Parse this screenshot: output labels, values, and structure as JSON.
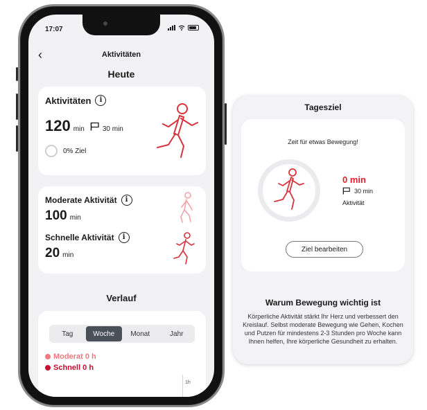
{
  "status_bar": {
    "time": "17:07"
  },
  "nav": {
    "back_glyph": "‹",
    "title": "Aktivitäten"
  },
  "today": {
    "heading": "Heute",
    "activities_card": {
      "label": "Aktivitäten",
      "value": "120",
      "unit": "min",
      "goal": "30 min",
      "goal_progress": "0% Ziel"
    },
    "split_card": {
      "moderate_label": "Moderate Aktivität",
      "moderate_value": "100",
      "moderate_unit": "min",
      "fast_label": "Schnelle Aktivität",
      "fast_value": "20",
      "fast_unit": "min"
    }
  },
  "history": {
    "heading": "Verlauf",
    "tabs": [
      "Tag",
      "Woche",
      "Monat",
      "Jahr"
    ],
    "active_tab": "Woche",
    "legend": [
      {
        "label": "Moderat 0 h",
        "color": "#f07a7f"
      },
      {
        "label": "Schnell 0 h",
        "color": "#c8102e"
      }
    ],
    "axis_label": "1h"
  },
  "goal_panel": {
    "title": "Tagesziel",
    "prompt": "Zeit für etwas Bewegung!",
    "current": "0 min",
    "goal": "30 min",
    "goal_caption": "Aktivität",
    "edit_button": "Ziel bearbeiten",
    "why_title": "Warum Bewegung wichtig ist",
    "why_text": "Körperliche Aktivität stärkt Ihr Herz und verbessert den Kreislauf. Selbst moderate Bewegung wie Gehen, Kochen und Putzen für mindestens 2-3 Stunden pro Woche kann Ihnen helfen, Ihre körperliche Gesundheit zu erhalten."
  },
  "colors": {
    "accent_red": "#e0202e",
    "figure_red": "#d8323c",
    "figure_pink": "#f3a3a8"
  },
  "icons": [
    "info-icon",
    "flag-icon",
    "runner-icon",
    "walker-icon",
    "back-chevron-icon"
  ]
}
